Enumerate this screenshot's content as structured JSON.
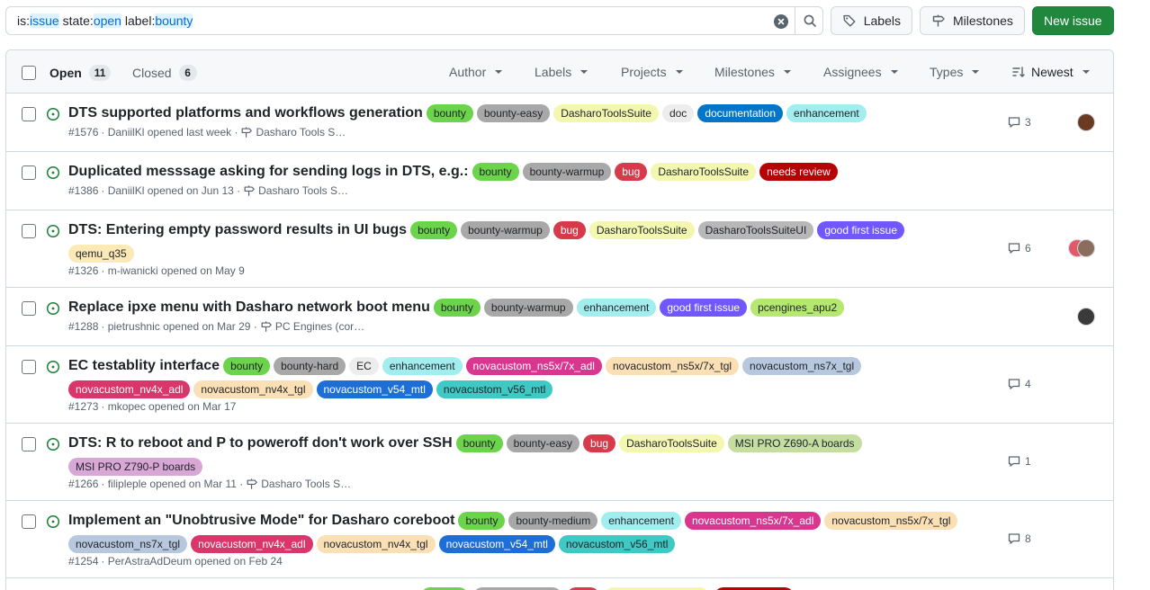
{
  "search": {
    "query_parts": [
      {
        "text": "is:",
        "hl": false
      },
      {
        "text": "issue",
        "hl": true
      },
      {
        "text": " state:",
        "hl": false
      },
      {
        "text": "open",
        "hl": true
      },
      {
        "text": " label:",
        "hl": false
      },
      {
        "text": "bounty",
        "hl": true
      }
    ]
  },
  "toolbar": {
    "labels": "Labels",
    "milestones": "Milestones",
    "new_issue": "New issue"
  },
  "header": {
    "open_label": "Open",
    "open_count": "11",
    "closed_label": "Closed",
    "closed_count": "6",
    "filters": [
      "Author",
      "Labels",
      "Projects",
      "Milestones",
      "Assignees",
      "Types"
    ],
    "sort": "Newest"
  },
  "issues": [
    {
      "title": "DTS supported platforms and workflows generation",
      "labels": [
        {
          "name": "bounty",
          "bg": "#6bd44a",
          "fg": "#1f2328"
        },
        {
          "name": "bounty-easy",
          "bg": "#a8a8a8",
          "fg": "#1f2328"
        },
        {
          "name": "DasharoToolsSuite",
          "bg": "#f3f7b0",
          "fg": "#1f2328"
        },
        {
          "name": "doc",
          "bg": "#ededed",
          "fg": "#1f2328"
        },
        {
          "name": "documentation",
          "bg": "#0075ca",
          "fg": "#ffffff"
        },
        {
          "name": "enhancement",
          "bg": "#a2eeef",
          "fg": "#1f2328"
        }
      ],
      "number": "#1576",
      "meta": " · DaniilKl opened last week ·",
      "milestone": "Dasharo Tools S…",
      "comments": "3",
      "avatars": [
        "#6b3a22"
      ]
    },
    {
      "title": "Duplicated messsage asking for sending logs in DTS, e.g.:",
      "labels": [
        {
          "name": "bounty",
          "bg": "#6bd44a",
          "fg": "#1f2328"
        },
        {
          "name": "bounty-warmup",
          "bg": "#a8a8a8",
          "fg": "#1f2328"
        },
        {
          "name": "bug",
          "bg": "#d73a4a",
          "fg": "#ffffff"
        },
        {
          "name": "DasharoToolsSuite",
          "bg": "#f3f7b0",
          "fg": "#1f2328"
        },
        {
          "name": "needs review",
          "bg": "#b60205",
          "fg": "#ffffff"
        }
      ],
      "number": "#1386",
      "meta": " · DaniilKl opened on Jun 13 ·",
      "milestone": "Dasharo Tools S…",
      "comments": "",
      "avatars": []
    },
    {
      "title": "DTS: Entering empty password results in UI bugs",
      "labels": [
        {
          "name": "bounty",
          "bg": "#6bd44a",
          "fg": "#1f2328"
        },
        {
          "name": "bounty-warmup",
          "bg": "#a8a8a8",
          "fg": "#1f2328"
        },
        {
          "name": "bug",
          "bg": "#d73a4a",
          "fg": "#ffffff"
        },
        {
          "name": "DasharoToolsSuite",
          "bg": "#f3f7b0",
          "fg": "#1f2328"
        },
        {
          "name": "DasharoToolsSuiteUI",
          "bg": "#b8b8b8",
          "fg": "#1f2328"
        },
        {
          "name": "good first issue",
          "bg": "#7057ff",
          "fg": "#ffffff"
        },
        {
          "name": "qemu_q35",
          "bg": "#fbe9b6",
          "fg": "#1f2328"
        }
      ],
      "number": "#1326",
      "meta": " · m-iwanicki opened on May 9",
      "milestone": "",
      "comments": "6",
      "avatars": [
        "#e05a6a",
        "#8a6d5c"
      ]
    },
    {
      "title": "Replace ipxe menu with Dasharo network boot menu",
      "labels": [
        {
          "name": "bounty",
          "bg": "#6bd44a",
          "fg": "#1f2328"
        },
        {
          "name": "bounty-warmup",
          "bg": "#a8a8a8",
          "fg": "#1f2328"
        },
        {
          "name": "enhancement",
          "bg": "#a2eeef",
          "fg": "#1f2328"
        },
        {
          "name": "good first issue",
          "bg": "#7057ff",
          "fg": "#ffffff"
        },
        {
          "name": "pcengines_apu2",
          "bg": "#b4e86e",
          "fg": "#1f2328"
        }
      ],
      "number": "#1288",
      "meta": " · pietrushnic opened on Mar 29 ·",
      "milestone": "PC Engines (cor…",
      "comments": "",
      "avatars": [
        "#3a3a3a"
      ]
    },
    {
      "title": "EC testablity interface",
      "labels": [
        {
          "name": "bounty",
          "bg": "#6bd44a",
          "fg": "#1f2328"
        },
        {
          "name": "bounty-hard",
          "bg": "#a8a8a8",
          "fg": "#1f2328"
        },
        {
          "name": "EC",
          "bg": "#ededed",
          "fg": "#1f2328"
        },
        {
          "name": "enhancement",
          "bg": "#a2eeef",
          "fg": "#1f2328"
        },
        {
          "name": "novacustom_ns5x/7x_adl",
          "bg": "#d9368f",
          "fg": "#ffffff"
        },
        {
          "name": "novacustom_ns5x/7x_tgl",
          "bg": "#fbdfb5",
          "fg": "#1f2328"
        },
        {
          "name": "novacustom_ns7x_tgl",
          "bg": "#b7c8de",
          "fg": "#1f2328"
        },
        {
          "name": "novacustom_nv4x_adl",
          "bg": "#d9366c",
          "fg": "#ffffff"
        },
        {
          "name": "novacustom_nv4x_tgl",
          "bg": "#fbdfb5",
          "fg": "#1f2328"
        },
        {
          "name": "novacustom_v54_mtl",
          "bg": "#1d6fd6",
          "fg": "#ffffff"
        },
        {
          "name": "novacustom_v56_mtl",
          "bg": "#3ec9c4",
          "fg": "#1f2328"
        }
      ],
      "number": "#1273",
      "meta": " · mkopec opened on Mar 17",
      "milestone": "",
      "comments": "4",
      "avatars": []
    },
    {
      "title": "DTS: R to reboot and P to poweroff don't work over SSH",
      "labels": [
        {
          "name": "bounty",
          "bg": "#6bd44a",
          "fg": "#1f2328"
        },
        {
          "name": "bounty-easy",
          "bg": "#a8a8a8",
          "fg": "#1f2328"
        },
        {
          "name": "bug",
          "bg": "#d73a4a",
          "fg": "#ffffff"
        },
        {
          "name": "DasharoToolsSuite",
          "bg": "#f3f7b0",
          "fg": "#1f2328"
        },
        {
          "name": "MSI PRO Z690-A boards",
          "bg": "#c5dea0",
          "fg": "#1f2328"
        },
        {
          "name": "MSI PRO Z790-P boards",
          "bg": "#d9a7d6",
          "fg": "#1f2328"
        }
      ],
      "number": "#1266",
      "meta": " · filipleple opened on Mar 11 ·",
      "milestone": "Dasharo Tools S…",
      "comments": "1",
      "avatars": []
    },
    {
      "title": "Implement an \"Unobtrusive Mode\" for Dasharo coreboot",
      "labels": [
        {
          "name": "bounty",
          "bg": "#6bd44a",
          "fg": "#1f2328"
        },
        {
          "name": "bounty-medium",
          "bg": "#a8a8a8",
          "fg": "#1f2328"
        },
        {
          "name": "enhancement",
          "bg": "#a2eeef",
          "fg": "#1f2328"
        },
        {
          "name": "novacustom_ns5x/7x_adl",
          "bg": "#d9368f",
          "fg": "#ffffff"
        },
        {
          "name": "novacustom_ns5x/7x_tgl",
          "bg": "#fbdfb5",
          "fg": "#1f2328"
        },
        {
          "name": "novacustom_ns7x_tgl",
          "bg": "#b7c8de",
          "fg": "#1f2328"
        },
        {
          "name": "novacustom_nv4x_adl",
          "bg": "#d9366c",
          "fg": "#ffffff"
        },
        {
          "name": "novacustom_nv4x_tgl",
          "bg": "#fbdfb5",
          "fg": "#1f2328"
        },
        {
          "name": "novacustom_v54_mtl",
          "bg": "#1d6fd6",
          "fg": "#ffffff"
        },
        {
          "name": "novacustom_v56_mtl",
          "bg": "#3ec9c4",
          "fg": "#1f2328"
        }
      ],
      "number": "#1254",
      "meta": " · PerAstraAdDeum opened on Feb 24",
      "milestone": "",
      "comments": "8",
      "avatars": []
    }
  ],
  "partial_row_labels": [
    {
      "bg": "#6bd44a"
    },
    {
      "bg": "#a8a8a8"
    },
    {
      "bg": "#d73a4a"
    },
    {
      "bg": "#f3f7b0"
    },
    {
      "bg": "#b60205"
    }
  ],
  "colors": {
    "open_icon": "#1a7f37",
    "primary_button": "#1f883d",
    "highlight": "#0969da"
  }
}
